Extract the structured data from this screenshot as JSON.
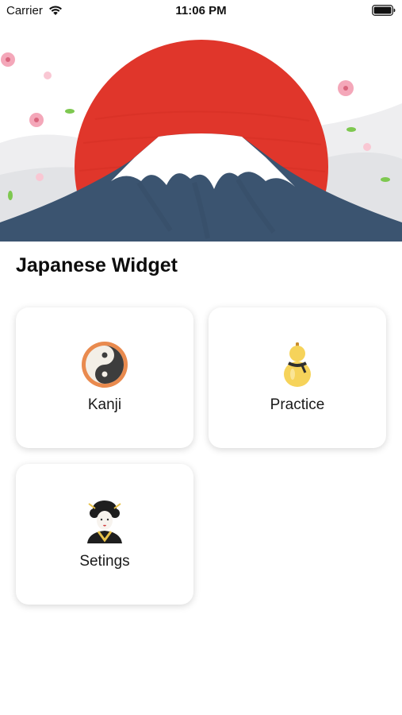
{
  "status_bar": {
    "carrier": "Carrier",
    "time": "11:06 PM",
    "icons": [
      "wifi-icon",
      "battery-icon"
    ]
  },
  "hero": {
    "image": "mount-fuji-rising-sun-illustration",
    "colors": {
      "sun": "#e0362b",
      "mountain": "#3b5470",
      "snow": "#ffffff",
      "blossom": "#f4a7b9",
      "leaf": "#7ec850"
    }
  },
  "app": {
    "title": "Japanese Widget"
  },
  "menu": {
    "items": [
      {
        "label": "Kanji",
        "icon": "yin-yang-icon"
      },
      {
        "label": "Practice",
        "icon": "gourd-icon"
      },
      {
        "label": "Setings",
        "icon": "geisha-icon"
      }
    ]
  }
}
